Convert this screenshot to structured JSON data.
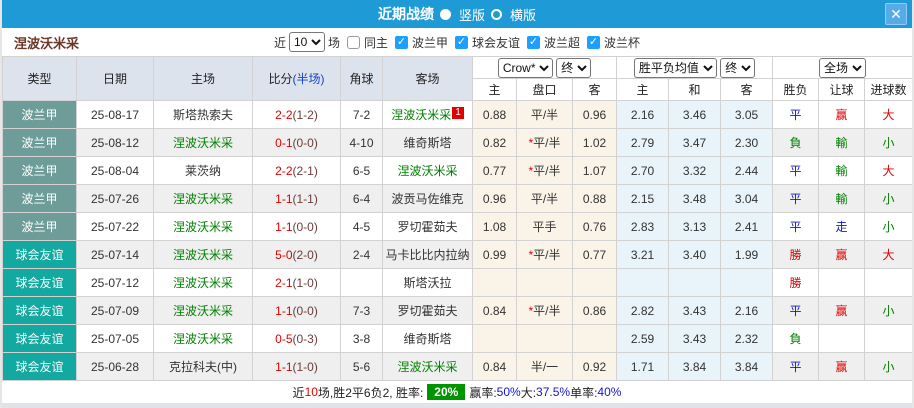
{
  "icons": {
    "close": "✕",
    "check": "✓"
  },
  "colors": {
    "red": "#e10000",
    "green": "#008000",
    "blue": "#1515cc",
    "type_league": "#6d9c99",
    "type_friendly": "#13a9a0"
  },
  "titlebar": {
    "title": "近期战绩",
    "radio_vertical": "竖版",
    "radio_horizontal": "横版"
  },
  "filter": {
    "team": "涅波沃米采",
    "near_label": "近",
    "count": "10",
    "field_label": "场",
    "same_home_label": "同主",
    "leagues": [
      "波兰甲",
      "球会友谊",
      "波兰超",
      "波兰杯"
    ]
  },
  "header": {
    "type": "类型",
    "date": "日期",
    "home": "主场",
    "score": "比分",
    "score_half": "(半场)",
    "corner": "角球",
    "away": "客场",
    "odds_select": "Crow*",
    "odds_final": "终",
    "odds_cols": [
      "主",
      "盘口",
      "客"
    ],
    "mean_select": "胜平负均值",
    "mean_final": "终",
    "mean_cols": [
      "主",
      "和",
      "客"
    ],
    "scope_select": "全场",
    "result_cols": [
      "胜负",
      "让球",
      "进球数"
    ]
  },
  "rows": [
    {
      "type": "波兰甲",
      "type_key": "league",
      "date": "25-08-17",
      "home": "斯塔热索夫",
      "home_main": false,
      "score_ft": "2-2",
      "score_ht": "(1-2)",
      "corner": "7-2",
      "away": "涅波沃米采",
      "away_main": true,
      "away_badge": "1",
      "odds": [
        "0.88",
        "平/半",
        "0.96"
      ],
      "odds_star": false,
      "mean": [
        "2.16",
        "3.46",
        "3.05"
      ],
      "wdl": {
        "t": "平",
        "c": "blue"
      },
      "handicap": {
        "t": "赢",
        "c": "red"
      },
      "goals": {
        "t": "大",
        "c": "red"
      }
    },
    {
      "type": "波兰甲",
      "type_key": "league",
      "date": "25-08-12",
      "home": "涅波沃米采",
      "home_main": true,
      "score_ft": "0-1",
      "score_ht": "(0-0)",
      "corner": "4-10",
      "away": "维奇斯塔",
      "away_main": false,
      "away_badge": "",
      "odds": [
        "0.82",
        "平/半",
        "1.02"
      ],
      "odds_star": true,
      "mean": [
        "2.79",
        "3.47",
        "2.30"
      ],
      "wdl": {
        "t": "負",
        "c": "green"
      },
      "handicap": {
        "t": "輸",
        "c": "green"
      },
      "goals": {
        "t": "小",
        "c": "green"
      }
    },
    {
      "type": "波兰甲",
      "type_key": "league",
      "date": "25-08-04",
      "home": "莱茨纳",
      "home_main": false,
      "score_ft": "2-2",
      "score_ht": "(2-1)",
      "corner": "6-5",
      "away": "涅波沃米采",
      "away_main": true,
      "away_badge": "",
      "odds": [
        "0.77",
        "平/半",
        "1.07"
      ],
      "odds_star": true,
      "mean": [
        "2.70",
        "3.32",
        "2.44"
      ],
      "wdl": {
        "t": "平",
        "c": "blue"
      },
      "handicap": {
        "t": "輸",
        "c": "green"
      },
      "goals": {
        "t": "大",
        "c": "red"
      }
    },
    {
      "type": "波兰甲",
      "type_key": "league",
      "date": "25-07-26",
      "home": "涅波沃米采",
      "home_main": true,
      "score_ft": "1-1",
      "score_ht": "(1-1)",
      "corner": "6-4",
      "away": "波贡马佐维克",
      "away_main": false,
      "away_badge": "",
      "odds": [
        "0.96",
        "平/半",
        "0.88"
      ],
      "odds_star": false,
      "mean": [
        "2.15",
        "3.48",
        "3.04"
      ],
      "wdl": {
        "t": "平",
        "c": "blue"
      },
      "handicap": {
        "t": "輸",
        "c": "green"
      },
      "goals": {
        "t": "小",
        "c": "green"
      }
    },
    {
      "type": "波兰甲",
      "type_key": "league",
      "date": "25-07-22",
      "home": "涅波沃米采",
      "home_main": true,
      "score_ft": "1-1",
      "score_ht": "(0-0)",
      "corner": "4-5",
      "away": "罗切霍茹夫",
      "away_main": false,
      "away_badge": "",
      "odds": [
        "1.08",
        "平手",
        "0.76"
      ],
      "odds_star": false,
      "mean": [
        "2.83",
        "3.13",
        "2.41"
      ],
      "wdl": {
        "t": "平",
        "c": "blue"
      },
      "handicap": {
        "t": "走",
        "c": "blue"
      },
      "goals": {
        "t": "小",
        "c": "green"
      }
    },
    {
      "type": "球会友谊",
      "type_key": "friendly",
      "date": "25-07-14",
      "home": "涅波沃米采",
      "home_main": true,
      "score_ft": "5-0",
      "score_ht": "(2-0)",
      "corner": "2-4",
      "away": "马卡比比内拉纳",
      "away_main": false,
      "away_badge": "",
      "odds": [
        "0.99",
        "平/半",
        "0.77"
      ],
      "odds_star": true,
      "mean": [
        "3.21",
        "3.40",
        "1.99"
      ],
      "wdl": {
        "t": "勝",
        "c": "red"
      },
      "handicap": {
        "t": "赢",
        "c": "red"
      },
      "goals": {
        "t": "大",
        "c": "red"
      }
    },
    {
      "type": "球会友谊",
      "type_key": "friendly",
      "date": "25-07-12",
      "home": "涅波沃米采",
      "home_main": true,
      "score_ft": "2-1",
      "score_ht": "(1-0)",
      "corner": "",
      "away": "斯塔沃拉",
      "away_main": false,
      "away_badge": "",
      "odds": [
        "",
        "",
        ""
      ],
      "odds_star": false,
      "mean": [
        "",
        "",
        ""
      ],
      "wdl": {
        "t": "勝",
        "c": "red"
      },
      "handicap": {
        "t": "",
        "c": "blue"
      },
      "goals": {
        "t": "",
        "c": "blue"
      }
    },
    {
      "type": "球会友谊",
      "type_key": "friendly",
      "date": "25-07-09",
      "home": "涅波沃米采",
      "home_main": true,
      "score_ft": "1-1",
      "score_ht": "(0-0)",
      "corner": "7-3",
      "away": "罗切霍茹夫",
      "away_main": false,
      "away_badge": "",
      "odds": [
        "0.84",
        "平/半",
        "0.86"
      ],
      "odds_star": true,
      "mean": [
        "2.82",
        "3.43",
        "2.16"
      ],
      "wdl": {
        "t": "平",
        "c": "blue"
      },
      "handicap": {
        "t": "赢",
        "c": "red"
      },
      "goals": {
        "t": "小",
        "c": "green"
      }
    },
    {
      "type": "球会友谊",
      "type_key": "friendly",
      "date": "25-07-05",
      "home": "涅波沃米采",
      "home_main": true,
      "score_ft": "0-5",
      "score_ht": "(0-3)",
      "corner": "3-8",
      "away": "维奇斯塔",
      "away_main": false,
      "away_badge": "",
      "odds": [
        "",
        "",
        ""
      ],
      "odds_star": false,
      "mean": [
        "2.59",
        "3.43",
        "2.32"
      ],
      "wdl": {
        "t": "負",
        "c": "green"
      },
      "handicap": {
        "t": "",
        "c": "blue"
      },
      "goals": {
        "t": "",
        "c": "blue"
      }
    },
    {
      "type": "球会友谊",
      "type_key": "friendly",
      "date": "25-06-28",
      "home": "克拉科夫(中)",
      "home_main": false,
      "score_ft": "1-1",
      "score_ht": "(1-0)",
      "corner": "5-6",
      "away": "涅波沃米采",
      "away_main": true,
      "away_badge": "",
      "odds": [
        "0.84",
        "半/一",
        "0.92"
      ],
      "odds_star": false,
      "mean": [
        "1.71",
        "3.84",
        "3.84"
      ],
      "wdl": {
        "t": "平",
        "c": "blue"
      },
      "handicap": {
        "t": "赢",
        "c": "red"
      },
      "goals": {
        "t": "小",
        "c": "green"
      }
    }
  ],
  "summary": {
    "parts": [
      {
        "t": "近",
        "s": "plain"
      },
      {
        "t": "10",
        "s": "red"
      },
      {
        "t": "场,胜2平6负2, 胜率: ",
        "s": "plain"
      },
      {
        "t": "20%",
        "s": "badge"
      },
      {
        "t": " 赢率:",
        "s": "plain"
      },
      {
        "t": "50%",
        "s": "blue"
      },
      {
        "t": " 大:",
        "s": "plain"
      },
      {
        "t": "37.5%",
        "s": "blue"
      },
      {
        "t": " 单率:",
        "s": "plain"
      },
      {
        "t": "40%",
        "s": "blue"
      }
    ]
  }
}
